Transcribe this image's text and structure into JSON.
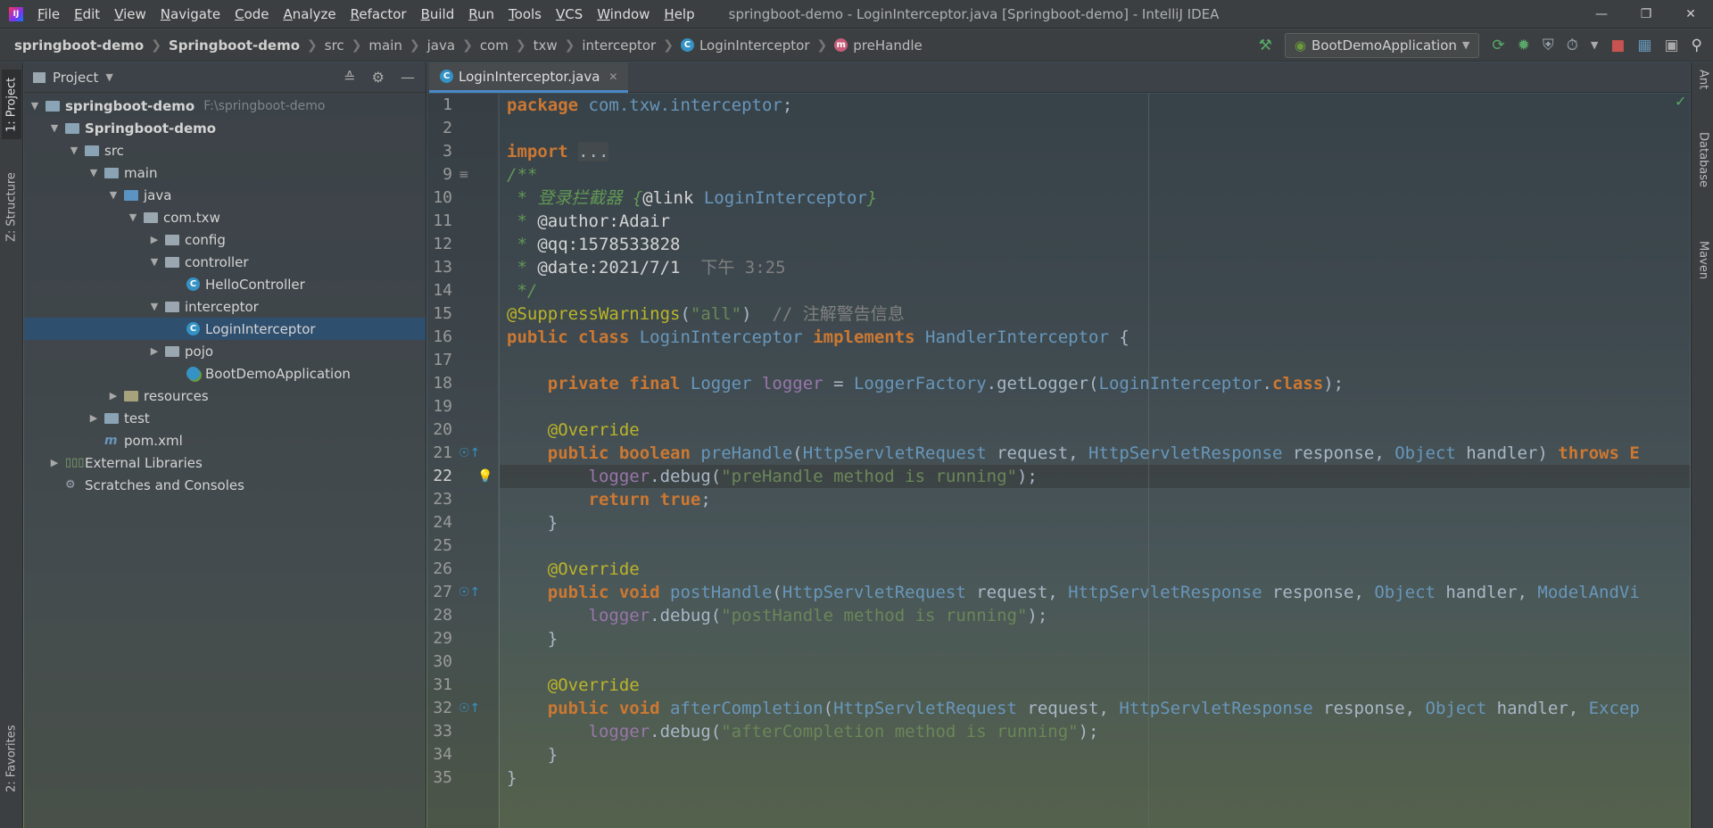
{
  "window": {
    "title": "springboot-demo - LoginInterceptor.java [Springboot-demo] - IntelliJ IDEA",
    "menu": [
      "File",
      "Edit",
      "View",
      "Navigate",
      "Code",
      "Analyze",
      "Refactor",
      "Build",
      "Run",
      "Tools",
      "VCS",
      "Window",
      "Help"
    ]
  },
  "breadcrumbs": [
    "springboot-demo",
    "Springboot-demo",
    "src",
    "main",
    "java",
    "com",
    "txw",
    "interceptor",
    "LoginInterceptor",
    "preHandle"
  ],
  "run_config": "BootDemoApplication",
  "left_tabs": {
    "project": "1: Project",
    "structure": "Z: Structure",
    "favorites": "2: Favorites"
  },
  "right_tabs": {
    "ant": "Ant",
    "database": "Database",
    "maven": "Maven"
  },
  "project_panel": {
    "title": "Project",
    "root_path": "F:\\springboot-demo",
    "tree": [
      "springboot-demo",
      "Springboot-demo",
      "src",
      "main",
      "java",
      "com.txw",
      "config",
      "controller",
      "HelloController",
      "interceptor",
      "LoginInterceptor",
      "pojo",
      "BootDemoApplication",
      "resources",
      "test",
      "pom.xml",
      "External Libraries",
      "Scratches and Consoles"
    ]
  },
  "editor": {
    "tab": "LoginInterceptor.java",
    "line_numbers": [
      "1",
      "2",
      "3",
      "9",
      "10",
      "11",
      "12",
      "13",
      "14",
      "15",
      "16",
      "17",
      "18",
      "19",
      "20",
      "21",
      "22",
      "23",
      "24",
      "25",
      "26",
      "27",
      "28",
      "29",
      "30",
      "31",
      "32",
      "33",
      "34",
      "35"
    ],
    "code": {
      "l1a": "package ",
      "l1b": "com.txw.interceptor",
      "l1c": ";",
      "l3a": "import ",
      "l3b": "...",
      "l9": "/**",
      "l10a": " * 登录拦截器 {",
      "l10b": "@link ",
      "l10c": "LoginInterceptor",
      "l10d": "}",
      "l11a": " * ",
      "l11b": "@author:Adair",
      "l12a": " * ",
      "l12b": "@qq:1578533828",
      "l13a": " * ",
      "l13b": "@date:2021/7/1",
      "l13c": "  下午 3:25",
      "l14": " */",
      "l15a": "@SuppressWarnings",
      "l15b": "(",
      "l15c": "\"all\"",
      "l15d": ")  ",
      "l15e": "// 注解警告信息",
      "l16a": "public class ",
      "l16b": "LoginInterceptor ",
      "l16c": "implements ",
      "l16d": "HandlerInterceptor ",
      "l16e": "{",
      "l18a": "    private final ",
      "l18b": "Logger ",
      "l18c": "logger",
      "l18d": " = ",
      "l18e": "LoggerFactory",
      "l18f": ".getLogger(",
      "l18g": "LoginInterceptor",
      "l18h": ".",
      "l18i": "class",
      "l18j": ");",
      "l20": "    @Override",
      "l21a": "    public boolean ",
      "l21b": "preHandle",
      "l21c": "(",
      "l21d": "HttpServletRequest ",
      "l21e": "request, ",
      "l21f": "HttpServletResponse ",
      "l21g": "response, ",
      "l21h": "Object ",
      "l21i": "handler) ",
      "l21j": "throws E",
      "l22a": "        ",
      "l22b": "logger",
      "l22c": ".debug(",
      "l22d": "\"preHandle method is running\"",
      "l22e": ");",
      "l23a": "        return true",
      "l23b": ";",
      "l24": "    }",
      "l26": "    @Override",
      "l27a": "    public void ",
      "l27b": "postHandle",
      "l27c": "(",
      "l27d": "HttpServletRequest ",
      "l27e": "request, ",
      "l27f": "HttpServletResponse ",
      "l27g": "response, ",
      "l27h": "Object ",
      "l27i": "handler, ",
      "l27j": "ModelAndVi",
      "l28a": "        ",
      "l28b": "logger",
      "l28c": ".debug(",
      "l28d": "\"postHandle method is running\"",
      "l28e": ");",
      "l29": "    }",
      "l31": "    @Override",
      "l32a": "    public void ",
      "l32b": "afterCompletion",
      "l32c": "(",
      "l32d": "HttpServletRequest ",
      "l32e": "request, ",
      "l32f": "HttpServletResponse ",
      "l32g": "response, ",
      "l32h": "Object ",
      "l32i": "handler, ",
      "l32j": "Excep",
      "l33a": "        ",
      "l33b": "logger",
      "l33c": ".debug(",
      "l33d": "\"afterCompletion method is running\"",
      "l33e": ");",
      "l34": "    }",
      "l35": "}"
    }
  }
}
